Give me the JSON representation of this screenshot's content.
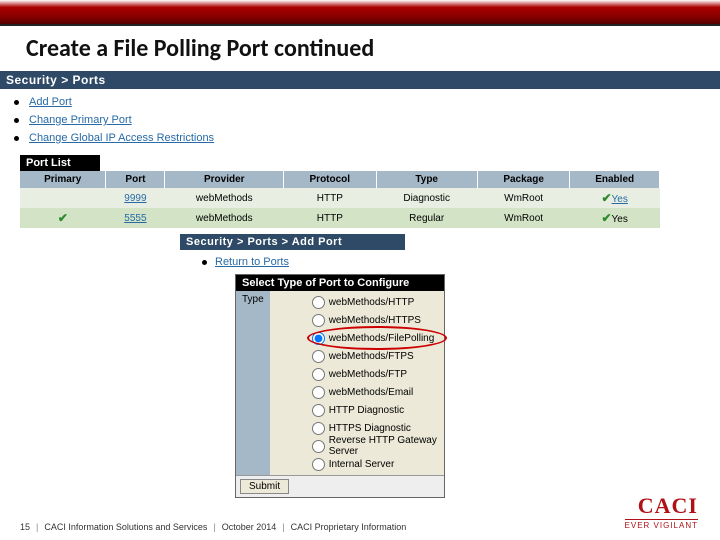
{
  "slide": {
    "title": "Create a File Polling Port continued"
  },
  "breadcrumb": {
    "main": "Security > Ports",
    "add": "Security > Ports > Add Port"
  },
  "links": {
    "add_port": "Add Port",
    "change_primary": "Change Primary Port",
    "change_global": "Change Global IP Access Restrictions",
    "return": "Return to Ports"
  },
  "port_list": {
    "header_label": "Port List",
    "cols": [
      "Primary",
      "Port",
      "Provider",
      "Protocol",
      "Type",
      "Package",
      "Enabled"
    ],
    "rows": [
      {
        "primary": "",
        "port": "9999",
        "provider": "webMethods",
        "protocol": "HTTP",
        "type": "Diagnostic",
        "package": "WmRoot",
        "enabled": "Yes",
        "enabled_link": true
      },
      {
        "primary": "✔",
        "port": "5555",
        "provider": "webMethods",
        "protocol": "HTTP",
        "type": "Regular",
        "package": "WmRoot",
        "enabled": "Yes",
        "enabled_link": false
      }
    ]
  },
  "type_panel": {
    "heading": "Select Type of Port to Configure",
    "label": "Type",
    "options": [
      "webMethods/HTTP",
      "webMethods/HTTPS",
      "webMethods/FilePolling",
      "webMethods/FTPS",
      "webMethods/FTP",
      "webMethods/Email",
      "HTTP Diagnostic",
      "HTTPS Diagnostic",
      "Reverse HTTP Gateway Server",
      "Internal Server"
    ],
    "selected_index": 2,
    "circled_index": 2,
    "submit": "Submit"
  },
  "footer": {
    "page": "15",
    "org": "CACI Information Solutions and Services",
    "date": "October 2014",
    "note": "CACI Proprietary Information"
  },
  "logo": {
    "name": "CACI",
    "tag": "EVER VIGILANT"
  }
}
